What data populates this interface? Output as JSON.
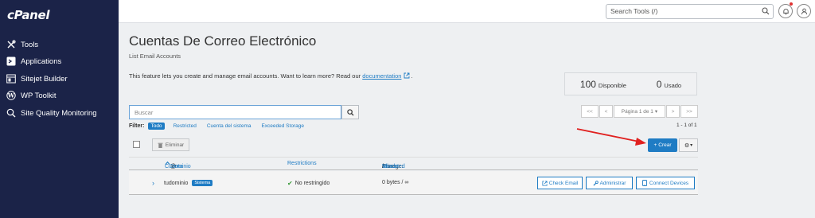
{
  "sidebar": {
    "logo": "cPanel",
    "items": [
      {
        "label": "Tools"
      },
      {
        "label": "Applications"
      },
      {
        "label": "Sitejet Builder"
      },
      {
        "label": "WP Toolkit"
      },
      {
        "label": "Site Quality Monitoring"
      }
    ]
  },
  "topbar": {
    "search_placeholder": "Search Tools (/)"
  },
  "page": {
    "title": "Cuentas De Correo Electrónico",
    "subtitle": "List Email Accounts",
    "desc_text": "This feature lets you create and manage email accounts. Want to learn more? Read our",
    "desc_link": "documentation",
    "desc_end": "."
  },
  "stats": {
    "available_value": "100",
    "available_label": "Disponible",
    "used_value": "0",
    "used_label": "Usado"
  },
  "search": {
    "placeholder": "Buscar"
  },
  "filter": {
    "label": "Filter:",
    "options": [
      "Todo",
      "Restricted",
      "Cuenta del sistema",
      "Exceeded Storage"
    ]
  },
  "pager": {
    "first": "<<",
    "prev": "<",
    "page": "Página 1 de 1",
    "next": ">",
    "last": ">>",
    "count": "1 - 1 of 1"
  },
  "toolbar": {
    "delete_label": "Eliminar",
    "create_label": "Crear"
  },
  "table": {
    "headers": {
      "account": "Cuenta",
      "at": "@",
      "domain": "Dominio",
      "restrictions": "Restrictions",
      "storage": "Storage:",
      "used": "Usado",
      "sep1": "/",
      "allocated": "Allocated",
      "sep2": "/",
      "percent": "%"
    },
    "rows": [
      {
        "account": "tudominio",
        "badge": "Sistema",
        "restriction": "No restringido",
        "storage": "0 bytes / ∞",
        "actions": [
          "Check Email",
          "Administrar",
          "Connect Devices"
        ]
      }
    ]
  },
  "colors": {
    "sidebar": "#1b2348",
    "accent": "#1f7cc4",
    "arrow": "#e0201f"
  }
}
